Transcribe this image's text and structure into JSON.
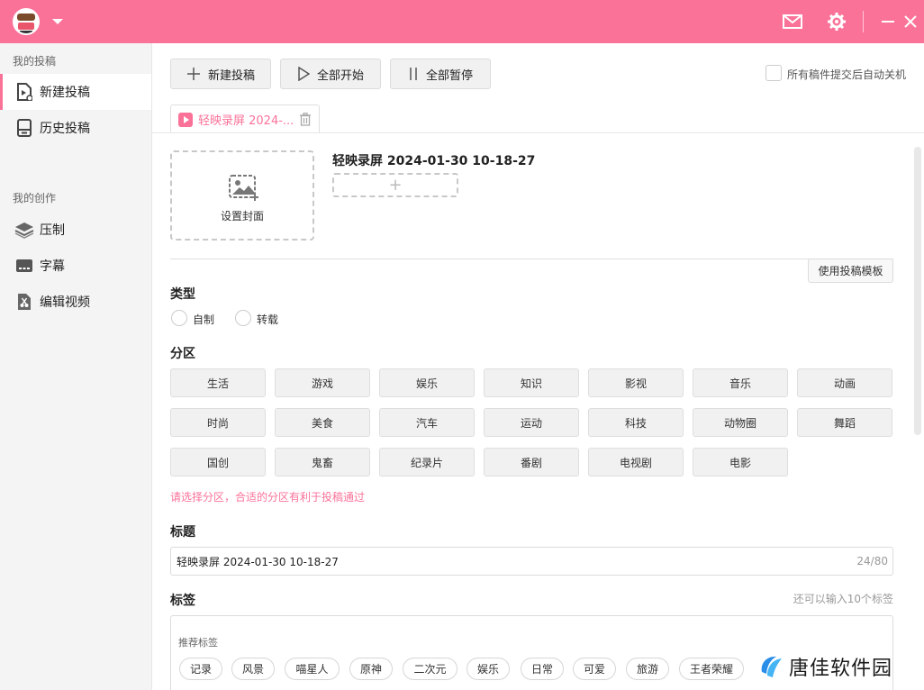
{
  "sidebar": {
    "section1": "我的投稿",
    "item_new": "新建投稿",
    "item_history": "历史投稿",
    "section2": "我的创作",
    "item_compress": "压制",
    "item_subtitle": "字幕",
    "item_edit": "编辑视频"
  },
  "toolbar": {
    "new_label": "新建投稿",
    "start_all_label": "全部开始",
    "pause_all_label": "全部暂停",
    "auto_shutdown_label": "所有稿件提交后自动关机"
  },
  "tab": {
    "label": "轻映录屏 2024-..."
  },
  "upload": {
    "cover_label": "设置封面",
    "video_title": "轻映录屏 2024-01-30 10-18-27",
    "add_symbol": "+"
  },
  "template_button": "使用投稿模板",
  "type_section": {
    "label": "类型",
    "options": [
      "自制",
      "转载"
    ]
  },
  "category_section": {
    "label": "分区",
    "items": [
      "生活",
      "游戏",
      "娱乐",
      "知识",
      "影视",
      "音乐",
      "动画",
      "时尚",
      "美食",
      "汽车",
      "运动",
      "科技",
      "动物圈",
      "舞蹈",
      "国创",
      "鬼畜",
      "纪录片",
      "番剧",
      "电视剧",
      "电影"
    ],
    "hint": "请选择分区，合适的分区有利于投稿通过"
  },
  "title_section": {
    "label": "标题",
    "value": "轻映录屏 2024-01-30 10-18-27",
    "count": "24/80"
  },
  "tags_section": {
    "label": "标签",
    "hint": "还可以输入10个标签",
    "recommend_label": "推荐标签",
    "items": [
      "记录",
      "风景",
      "喵星人",
      "原神",
      "二次元",
      "娱乐",
      "日常",
      "可爱",
      "旅游",
      "王者荣耀"
    ]
  },
  "watermark": "唐佳软件园",
  "colors": {
    "accent": "#fb7299"
  }
}
